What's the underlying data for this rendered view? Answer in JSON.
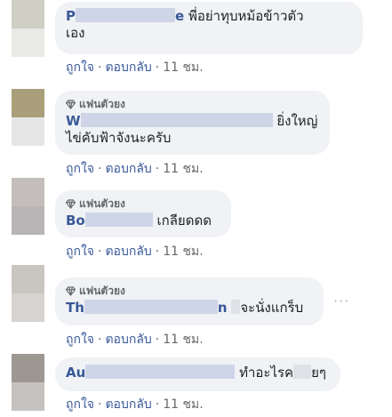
{
  "badge_label": "แฟนตัวยง",
  "like_label": "ถูกใจ",
  "reply_label": "ตอบกลับ",
  "separator": "·",
  "more_glyph": "···",
  "comments": [
    {
      "name_visible_start": "P",
      "name_visible_end": "e",
      "text_line1": "พี่อย่าทุบหม้อข้าวตัว",
      "text_line2": "เอง",
      "time": "11 ชม."
    },
    {
      "badge": true,
      "name_visible_start": "W",
      "text_line1": "ยิ่งใหญ่",
      "text_line2": "ไข่คับฟ้าจังนะครับ",
      "time": "11 ชม."
    },
    {
      "badge": true,
      "name_visible_start": "Bo",
      "text_line1": "เกลียดดด",
      "time": "11 ชม."
    },
    {
      "badge": true,
      "name_visible_start": "Th",
      "name_visible_end": "n",
      "text_line1": "จะนั่งแกร็บ",
      "time": "11 ชม."
    },
    {
      "name_visible_start": "Au",
      "text_line1a": "ทำอะไรค",
      "text_line1b": "ยๆ",
      "time": "11 ชม."
    }
  ]
}
